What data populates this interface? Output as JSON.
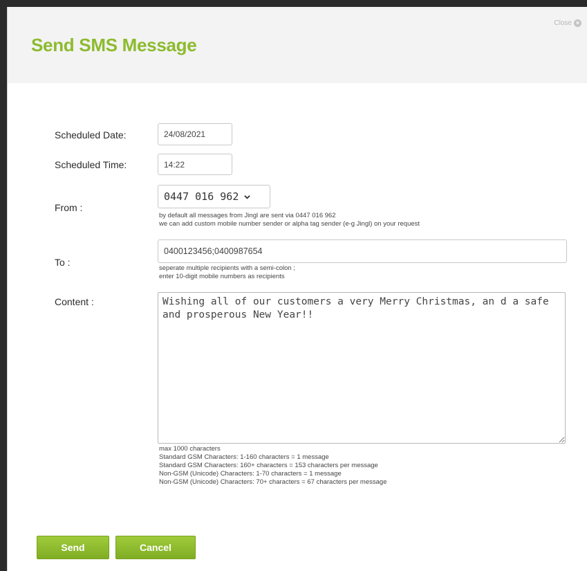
{
  "dialog": {
    "title": "Send SMS Message",
    "close_label": "Close"
  },
  "form": {
    "scheduled_date": {
      "label": "Scheduled Date:",
      "value": "24/08/2021"
    },
    "scheduled_time": {
      "label": "Scheduled Time:",
      "value": "14:22"
    },
    "from": {
      "label": "From :",
      "selected": "0447 016 962",
      "hints": [
        "by default all messages from Jingl are sent via 0447 016 962",
        "we can add custom mobile number sender or alpha tag sender (e-g Jingl) on your request"
      ]
    },
    "to": {
      "label": "To :",
      "value": "0400123456;0400987654",
      "hints": [
        "seperate multiple recipients with a semi-colon ;",
        "enter 10-digit mobile numbers as recipients"
      ]
    },
    "content": {
      "label": "Content :",
      "value": "Wishing all of our customers a very Merry Christmas, an d a safe and prosperous New Year!!",
      "hints": [
        "max 1000 characters",
        "Standard GSM Characters: 1-160 characters = 1 message",
        "Standard GSM Characters: 160+ characters = 153 characters per message",
        "Non-GSM (Unicode) Characters: 1-70 characters = 1 message",
        "Non-GSM (Unicode) Characters: 70+ characters = 67 characters per message"
      ]
    }
  },
  "actions": {
    "send_label": "Send",
    "cancel_label": "Cancel"
  },
  "colors": {
    "accent": "#8dbb2f",
    "button": "#8fbc2f"
  }
}
